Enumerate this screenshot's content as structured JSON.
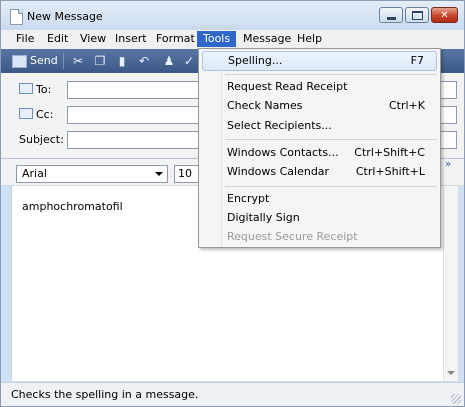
{
  "window": {
    "title": "New Message"
  },
  "menubar": [
    "File",
    "Edit",
    "View",
    "Insert",
    "Format",
    "Tools",
    "Message",
    "Help"
  ],
  "toolbar": {
    "send_label": "Send"
  },
  "fields": {
    "to_label": "To:",
    "cc_label": "Cc:",
    "subject_label": "Subject:"
  },
  "format": {
    "font": "Arial",
    "size": "10"
  },
  "body": {
    "text": "amphochromatofil"
  },
  "tools_menu": {
    "spelling": {
      "label": "Spelling...",
      "shortcut": "F7"
    },
    "read_receipt": {
      "label": "Request Read Receipt"
    },
    "check_names": {
      "label": "Check Names",
      "shortcut": "Ctrl+K"
    },
    "select_recipients": {
      "label": "Select Recipients..."
    },
    "windows_contacts": {
      "label": "Windows Contacts...",
      "shortcut": "Ctrl+Shift+C"
    },
    "windows_calendar": {
      "label": "Windows Calendar",
      "shortcut": "Ctrl+Shift+L"
    },
    "encrypt": {
      "label": "Encrypt"
    },
    "digitally_sign": {
      "label": "Digitally Sign"
    },
    "secure_receipt": {
      "label": "Request Secure Receipt"
    }
  },
  "status": {
    "text": "Checks the spelling in a message."
  },
  "colors": {
    "menu_highlight": "#2f68c8",
    "toolbar": "#3a5887"
  }
}
